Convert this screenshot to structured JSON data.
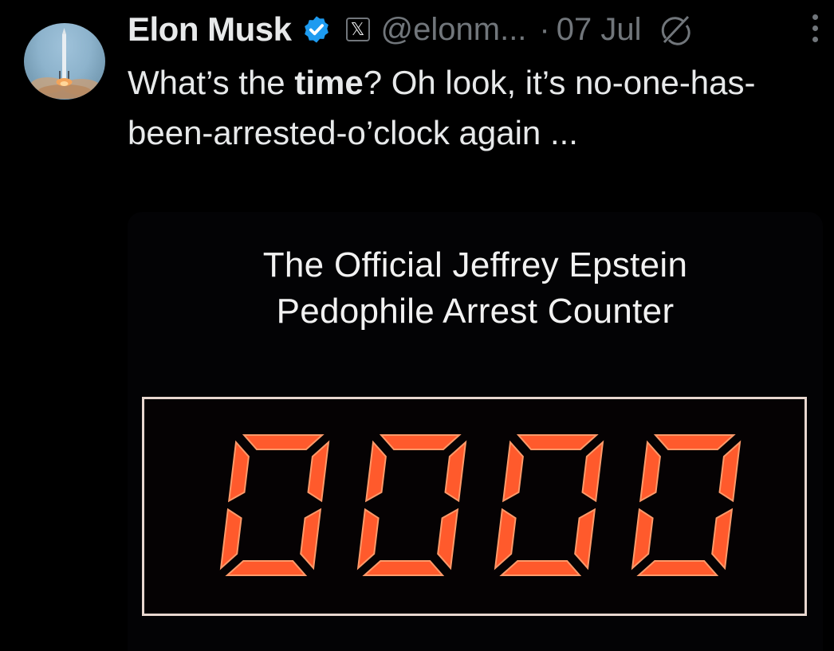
{
  "tweet": {
    "author_name": "Elon Musk",
    "handle": "@elonm...",
    "separator": "·",
    "date": "07 Jul",
    "text_before": "What’s the ",
    "text_bold": "time",
    "text_after": "? Oh look, it’s no-one-has-been-arrested-o’clock again ..."
  },
  "media": {
    "title_line1": "The Official Jeffrey Epstein",
    "title_line2": "Pedophile Arrest Counter",
    "counter_value": "0000"
  },
  "icons": {
    "verified": "verified-badge-icon",
    "x_logo": "x-logo-icon",
    "grok": "grok-icon",
    "more": "more-options-icon"
  },
  "colors": {
    "background": "#000000",
    "text": "#e7e9ea",
    "muted": "#71767b",
    "verified": "#1d9bf0",
    "counter_digit": "#ff5a2c"
  }
}
